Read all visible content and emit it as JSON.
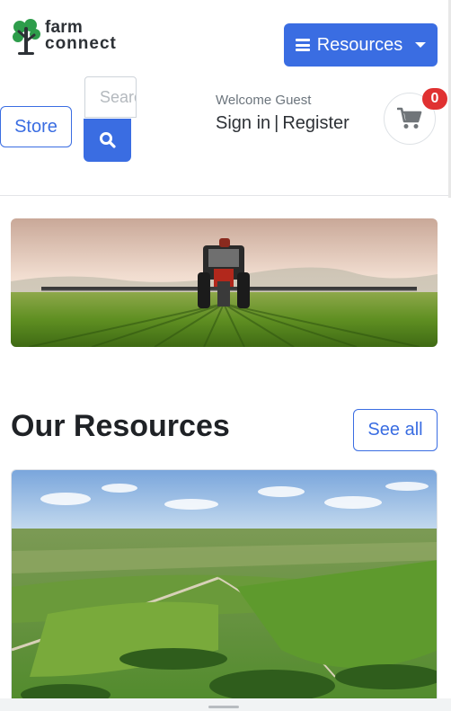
{
  "header": {
    "logo": {
      "line1": "farm",
      "line2": "connect"
    },
    "resources_label": "Resources",
    "store_label": "Store",
    "search": {
      "placeholder": "Search"
    },
    "welcome_text": "Welcome Guest",
    "signin_label": "Sign in",
    "separator": "|",
    "register_label": "Register",
    "cart_count": "0"
  },
  "main": {
    "section_title": "Our Resources",
    "see_all_label": "See all"
  },
  "colors": {
    "primary": "#3a6de2",
    "badge": "#e03131",
    "logo_green": "#2e9d4b"
  },
  "icons": [
    "tree-logo-icon",
    "hamburger-icon",
    "caret-down-icon",
    "search-icon",
    "cart-icon"
  ]
}
